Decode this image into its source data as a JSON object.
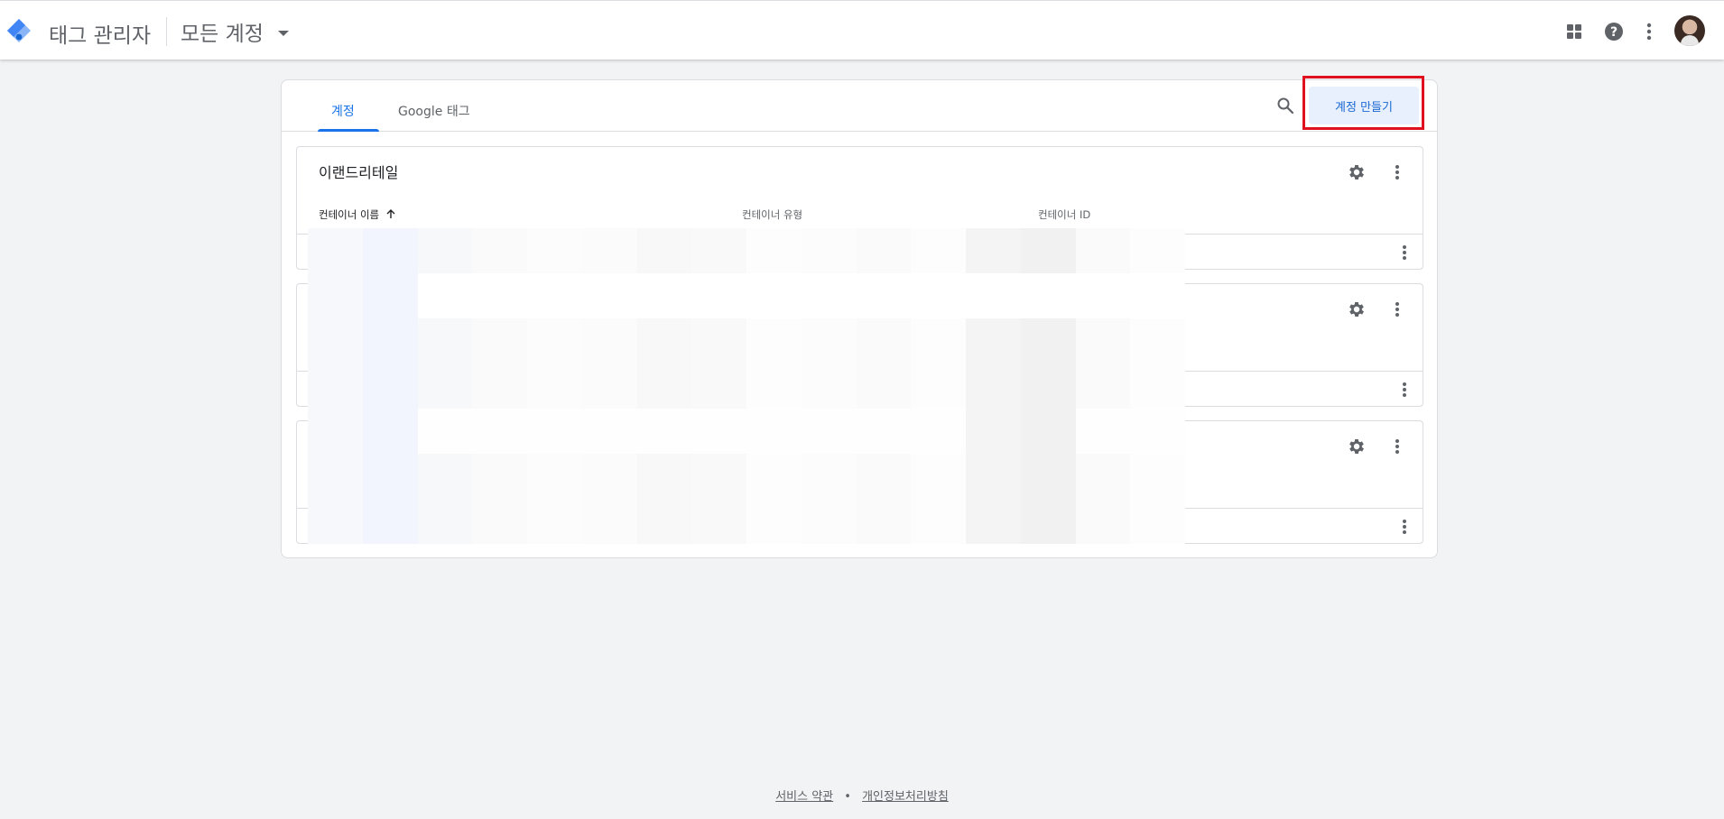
{
  "header": {
    "app_title": "태그 관리자",
    "account_picker_label": "모든 계정",
    "icons": [
      "apps-grid-icon",
      "help-icon",
      "more-vert-icon",
      "avatar"
    ]
  },
  "tabs": [
    {
      "label": "계정",
      "active": true
    },
    {
      "label": "Google 태그",
      "active": false
    }
  ],
  "toolbar": {
    "create_account_label": "계정 만들기"
  },
  "accounts": [
    {
      "name": "이랜드리테일",
      "columns": [
        "컨테이너 이름",
        "컨테이너 유형",
        "컨테이너 ID"
      ],
      "sorted_column": "컨테이너 이름",
      "sort_direction": "ascending"
    },
    {
      "name": ""
    },
    {
      "name": ""
    }
  ],
  "footer": {
    "terms": "서비스 약관",
    "separator": "•",
    "privacy": "개인정보처리방침"
  },
  "colors": {
    "accent": "#1a73e8",
    "create_button_bg": "#e8f0fe",
    "highlight_box": "#e0101e",
    "page_bg": "#f1f3f4"
  }
}
